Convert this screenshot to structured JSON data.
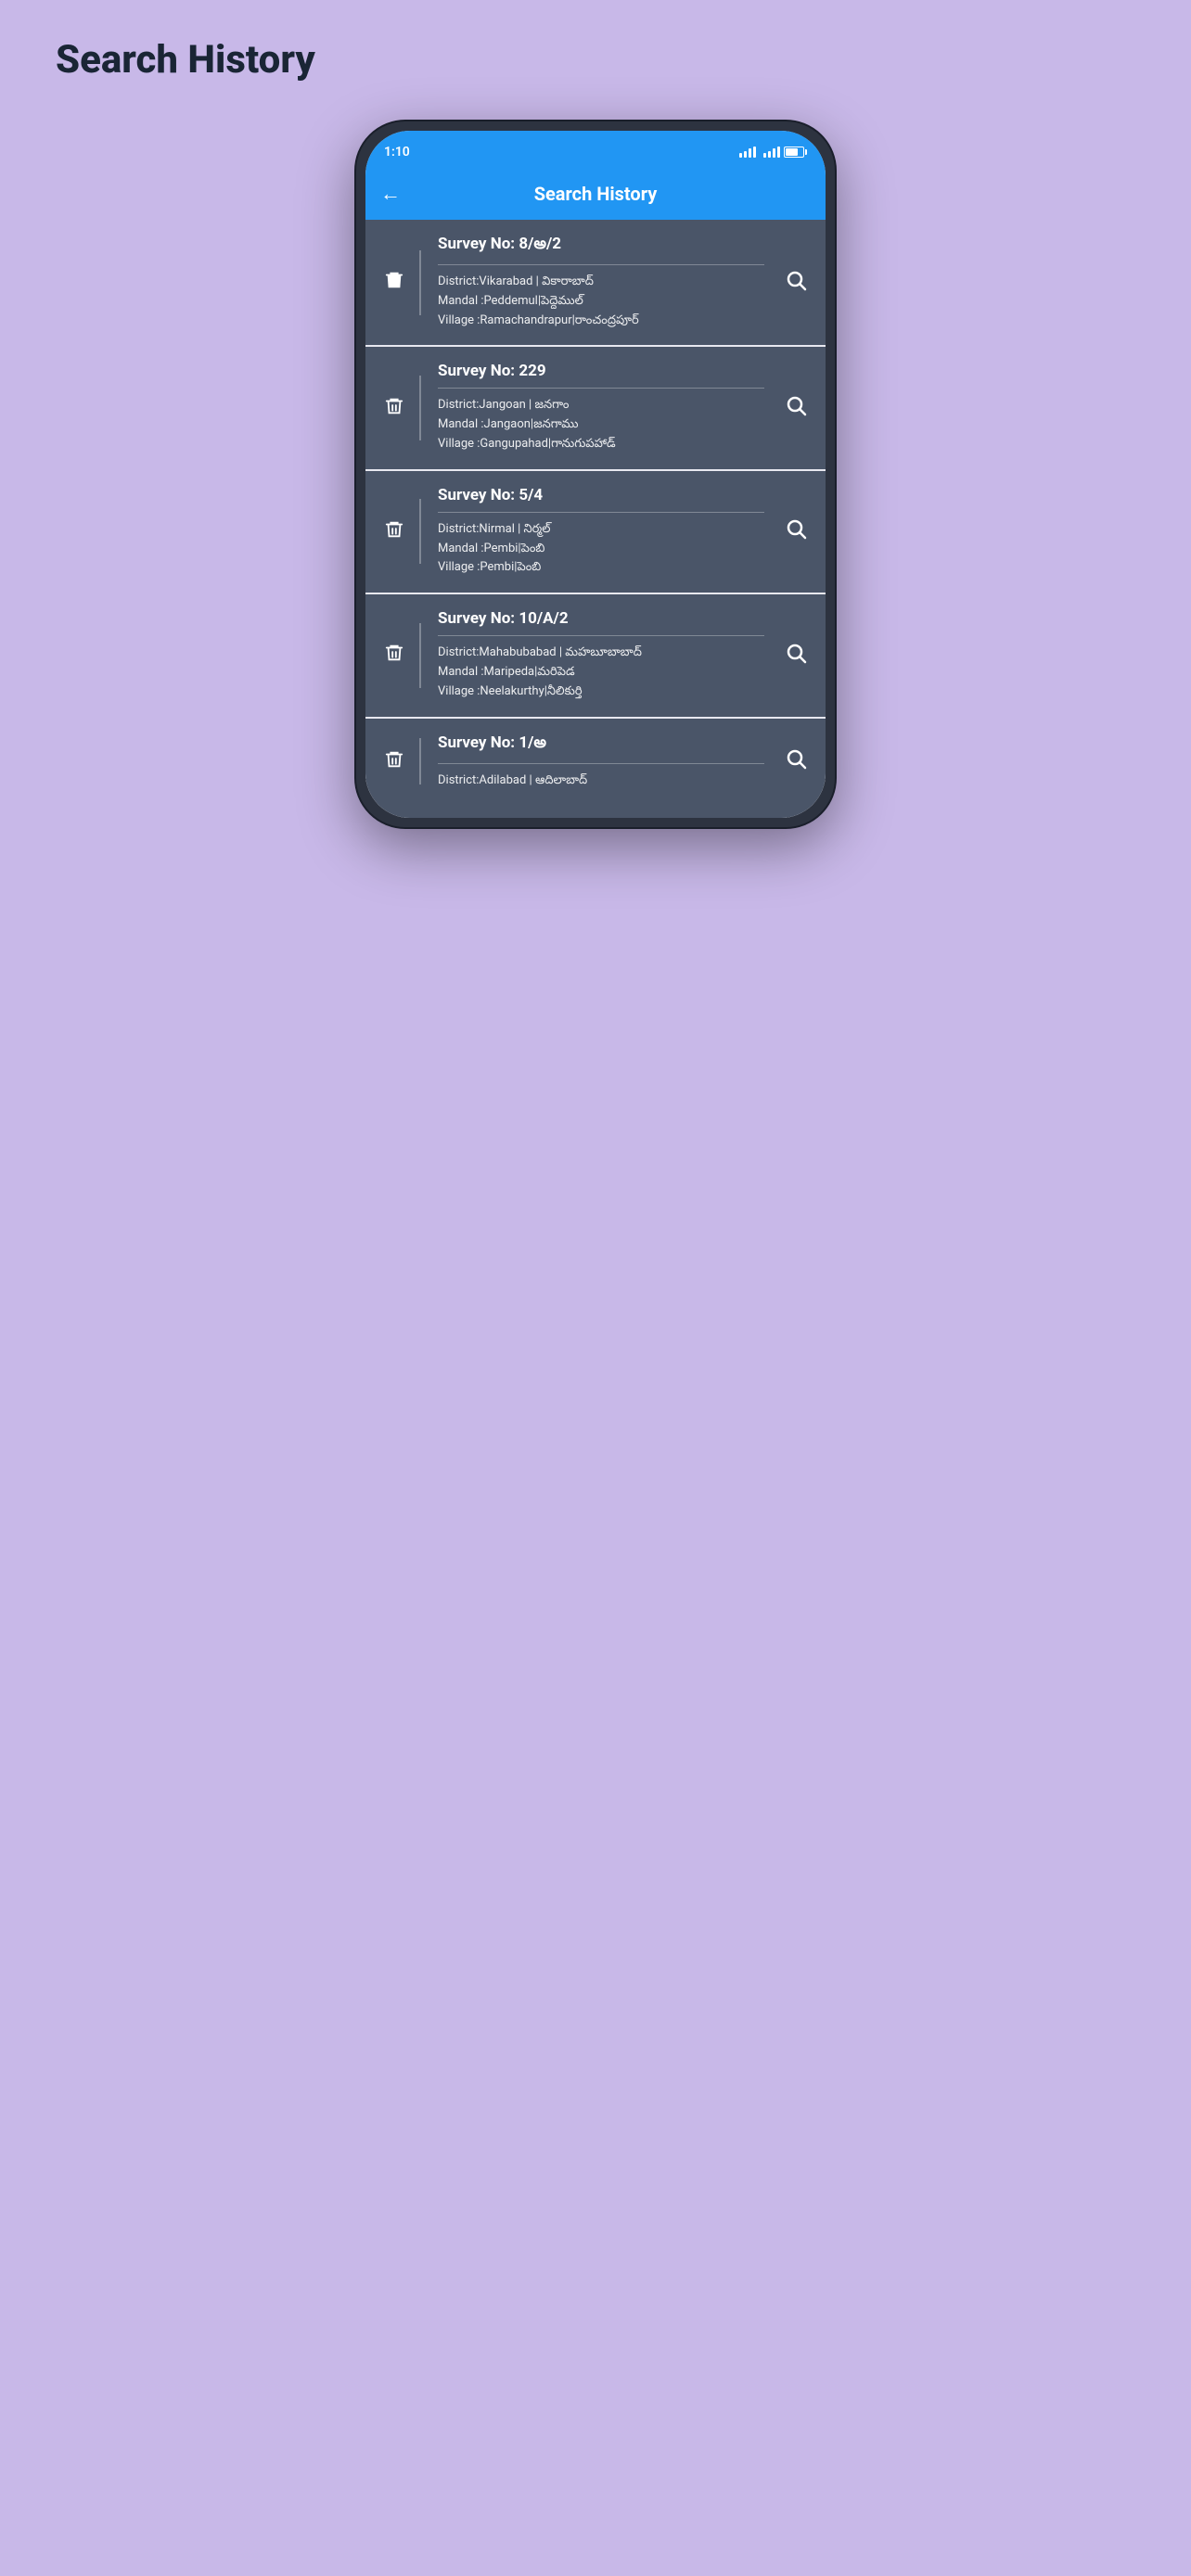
{
  "page": {
    "background_title": "Search History",
    "background_color": "#c8b8e8"
  },
  "status_bar": {
    "time": "1:10",
    "battery": "33"
  },
  "header": {
    "title": "Search History",
    "back_label": "←"
  },
  "history_items": [
    {
      "id": 1,
      "survey_no": "Survey No: 8/అ/2",
      "district": "District:Vikarabad | వికారాబాద్",
      "mandal": "Mandal :Peddemul|పెద్దెముల్",
      "village": "Village :Ramachandrapur|రాంచంద్రపూర్"
    },
    {
      "id": 2,
      "survey_no": "Survey No: 229",
      "district": "District:Jangoan | జనగాం",
      "mandal": "Mandal :Jangaon|జనగాము",
      "village": "Village :Gangupahad|గానుగుపహాడ్"
    },
    {
      "id": 3,
      "survey_no": "Survey No: 5/4",
      "district": "District:Nirmal | నిర్మల్",
      "mandal": "Mandal :Pembi|పెంబి",
      "village": "Village :Pembi|పెంబి"
    },
    {
      "id": 4,
      "survey_no": "Survey No: 10/A/2",
      "district": "District:Mahabubabad | మహబూబాబాద్",
      "mandal": "Mandal :Maripeda|మరిపెడ",
      "village": "Village :Neelakurthy|నీలికుర్తి"
    },
    {
      "id": 5,
      "survey_no": "Survey No: 1/అ",
      "district": "District:Adilabad | ఆదిలాబాద్",
      "mandal": "",
      "village": ""
    }
  ]
}
